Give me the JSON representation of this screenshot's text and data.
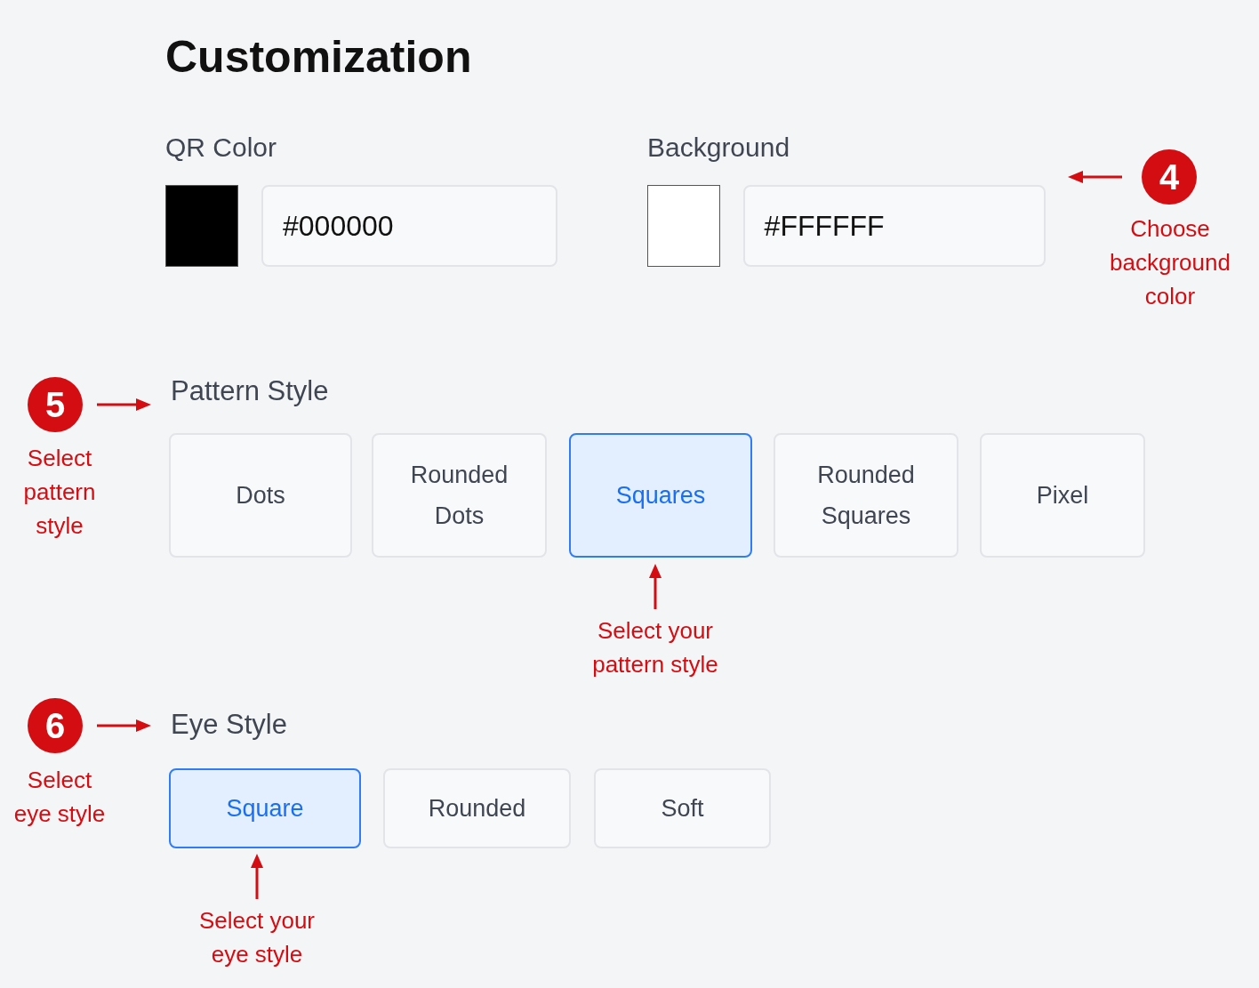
{
  "title": "Customization",
  "colors": [
    {
      "label": "QR Color",
      "color": "#000000",
      "value": "#000000"
    },
    {
      "label": "Background",
      "color": "#ffffff",
      "value": "#FFFFFF"
    }
  ],
  "pattern_style": {
    "label": "Pattern Style",
    "options": [
      {
        "label": "Dots",
        "selected": false
      },
      {
        "label": "Rounded Dots",
        "selected": false
      },
      {
        "label": "Squares",
        "selected": true
      },
      {
        "label": "Rounded Squares",
        "selected": false
      },
      {
        "label": "Pixel",
        "selected": false
      }
    ]
  },
  "eye_style": {
    "label": "Eye Style",
    "options": [
      {
        "label": "Square",
        "selected": true
      },
      {
        "label": "Rounded",
        "selected": false
      },
      {
        "label": "Soft",
        "selected": false
      }
    ]
  },
  "annotations": [
    {
      "number": "4",
      "text": "Choose background color"
    },
    {
      "number": "5",
      "text": "Select pattern style"
    },
    {
      "number": "6",
      "text": "Select eye style"
    }
  ],
  "callouts": [
    {
      "text": "Select your pattern style"
    },
    {
      "text": "Select your eye style"
    }
  ]
}
